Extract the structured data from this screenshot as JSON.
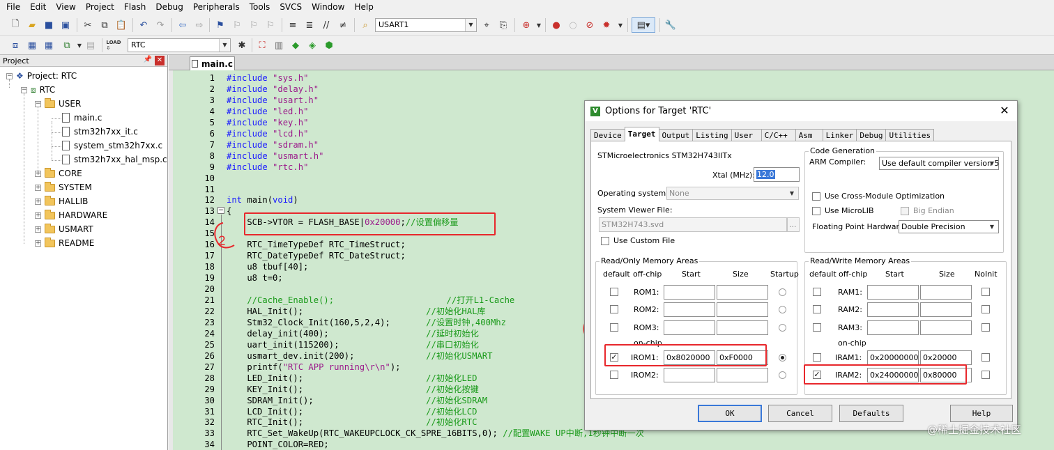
{
  "menu": [
    "File",
    "Edit",
    "View",
    "Project",
    "Flash",
    "Debug",
    "Peripherals",
    "Tools",
    "SVCS",
    "Window",
    "Help"
  ],
  "toolbar": {
    "target_combo": "USART1",
    "build_target": "RTC"
  },
  "project_panel": {
    "title": "Project",
    "root": "Project: RTC",
    "target": "RTC",
    "groups": [
      {
        "name": "USER",
        "files": [
          "main.c",
          "stm32h7xx_it.c",
          "system_stm32h7xx.c",
          "stm32h7xx_hal_msp.c"
        ]
      },
      {
        "name": "CORE"
      },
      {
        "name": "SYSTEM"
      },
      {
        "name": "HALLIB"
      },
      {
        "name": "HARDWARE"
      },
      {
        "name": "USMART"
      },
      {
        "name": "README"
      }
    ]
  },
  "editor": {
    "tab": "main.c",
    "lines": [
      {
        "n": "1",
        "t": "#include \"sys.h\""
      },
      {
        "n": "2",
        "t": "#include \"delay.h\""
      },
      {
        "n": "3",
        "t": "#include \"usart.h\""
      },
      {
        "n": "4",
        "t": "#include \"led.h\""
      },
      {
        "n": "5",
        "t": "#include \"key.h\""
      },
      {
        "n": "6",
        "t": "#include \"lcd.h\""
      },
      {
        "n": "7",
        "t": "#include \"sdram.h\""
      },
      {
        "n": "8",
        "t": "#include \"usmart.h\""
      },
      {
        "n": "9",
        "t": "#include \"rtc.h\""
      },
      {
        "n": "10",
        "t": ""
      },
      {
        "n": "11",
        "t": ""
      },
      {
        "n": "12",
        "t": "int main(void)"
      },
      {
        "n": "13",
        "t": "{"
      },
      {
        "n": "14",
        "t": "    SCB->VTOR = FLASH_BASE|0x20000;//设置偏移量"
      },
      {
        "n": "15",
        "t": ""
      },
      {
        "n": "16",
        "t": "    RTC_TimeTypeDef RTC_TimeStruct;"
      },
      {
        "n": "17",
        "t": "    RTC_DateTypeDef RTC_DateStruct;"
      },
      {
        "n": "18",
        "t": "    u8 tbuf[40];"
      },
      {
        "n": "19",
        "t": "    u8 t=0;"
      },
      {
        "n": "20",
        "t": ""
      },
      {
        "n": "21",
        "t": "    //Cache_Enable();                      //打开L1-Cache"
      },
      {
        "n": "22",
        "t": "    HAL_Init();                        //初始化HAL库"
      },
      {
        "n": "23",
        "t": "    Stm32_Clock_Init(160,5,2,4);       //设置时钟,400Mhz"
      },
      {
        "n": "24",
        "t": "    delay_init(400);                   //延时初始化"
      },
      {
        "n": "25",
        "t": "    uart_init(115200);                 //串口初始化"
      },
      {
        "n": "26",
        "t": "    usmart_dev.init(200);              //初始化USMART"
      },
      {
        "n": "27",
        "t": "    printf(\"RTC APP running\\r\\n\");"
      },
      {
        "n": "28",
        "t": "    LED_Init();                        //初始化LED"
      },
      {
        "n": "29",
        "t": "    KEY_Init();                        //初始化按键"
      },
      {
        "n": "30",
        "t": "    SDRAM_Init();                      //初始化SDRAM"
      },
      {
        "n": "31",
        "t": "    LCD_Init();                        //初始化LCD"
      },
      {
        "n": "32",
        "t": "    RTC_Init();                        //初始化RTC"
      },
      {
        "n": "33",
        "t": "    RTC_Set_WakeUp(RTC_WAKEUPCLOCK_CK_SPRE_16BITS,0); //配置WAKE UP中断,1秒钟中断一次"
      },
      {
        "n": "34",
        "t": "    POINT_COLOR=RED;"
      }
    ]
  },
  "dialog": {
    "title": "Options for Target 'RTC'",
    "tabs": [
      "Device",
      "Target",
      "Output",
      "Listing",
      "User",
      "C/C++",
      "Asm",
      "Linker",
      "Debug",
      "Utilities"
    ],
    "active_tab": "Target",
    "device": "STMicroelectronics STM32H743IITx",
    "xtal_label": "Xtal (MHz):",
    "xtal_value": "12.0",
    "os_label": "Operating system:",
    "os_value": "None",
    "svd_label": "System Viewer File:",
    "svd_value": "STM32H743.svd",
    "svd_browse": "...",
    "custom_file": "Use Custom File",
    "codegen": {
      "title": "Code Generation",
      "compiler_label": "ARM Compiler:",
      "compiler_value": "Use default compiler version 5",
      "cross_module": "Use Cross-Module Optimization",
      "microlib": "Use MicroLIB",
      "big_endian": "Big Endian",
      "fpu_label": "Floating Point Hardware:",
      "fpu_value": "Double Precision"
    },
    "ro": {
      "title": "Read/Only Memory Areas",
      "headers": [
        "default",
        "off-chip",
        "Start",
        "Size",
        "Startup"
      ],
      "onchip": "on-chip",
      "rows": [
        {
          "name": "ROM1:",
          "start": "",
          "size": ""
        },
        {
          "name": "ROM2:",
          "start": "",
          "size": ""
        },
        {
          "name": "ROM3:",
          "start": "",
          "size": ""
        },
        {
          "name": "IROM1:",
          "start": "0x8020000",
          "size": "0xF0000"
        },
        {
          "name": "IROM2:",
          "start": "",
          "size": ""
        }
      ]
    },
    "rw": {
      "title": "Read/Write Memory Areas",
      "headers": [
        "default",
        "off-chip",
        "Start",
        "Size",
        "NoInit"
      ],
      "onchip": "on-chip",
      "rows": [
        {
          "name": "RAM1:",
          "start": "",
          "size": ""
        },
        {
          "name": "RAM2:",
          "start": "",
          "size": ""
        },
        {
          "name": "RAM3:",
          "start": "",
          "size": ""
        },
        {
          "name": "IRAM1:",
          "start": "0x20000000",
          "size": "0x20000"
        },
        {
          "name": "IRAM2:",
          "start": "0x24000000",
          "size": "0x80000"
        }
      ]
    },
    "buttons": {
      "ok": "OK",
      "cancel": "Cancel",
      "defaults": "Defaults",
      "help": "Help"
    }
  },
  "annotations": {
    "mark1": "1",
    "mark2": "2"
  },
  "watermark": "@稀土掘金技术社区",
  "colors": {
    "editor_bg": "#cfe8cf",
    "annotation": "#e8272c"
  }
}
